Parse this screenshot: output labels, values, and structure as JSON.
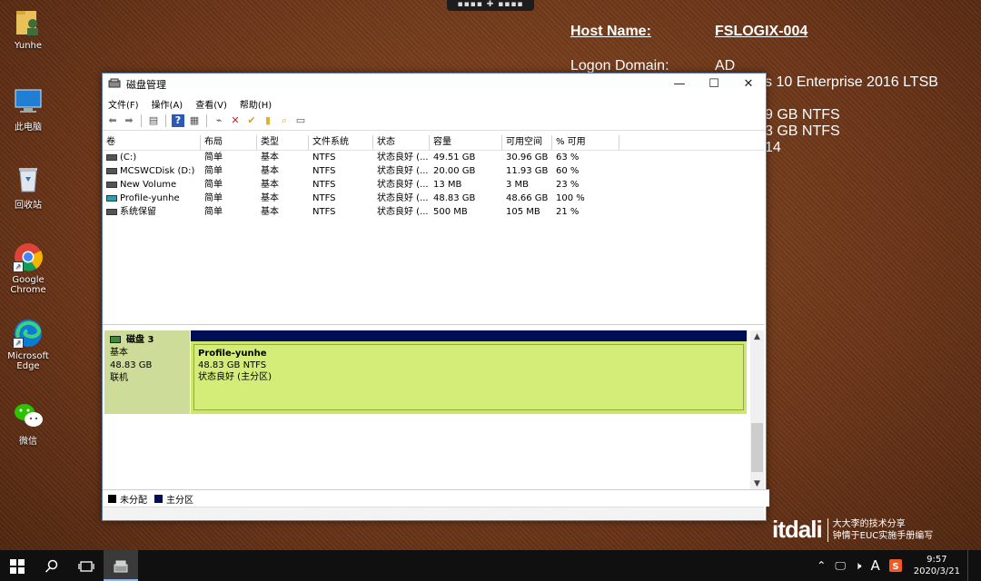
{
  "desktop": {
    "icons": [
      {
        "label": "Yunhe"
      },
      {
        "label": "此电脑"
      },
      {
        "label": "回收站"
      },
      {
        "label": "Google Chrome"
      },
      {
        "label": "Microsoft Edge"
      },
      {
        "label": "微信"
      }
    ]
  },
  "bginfo": {
    "host_label": "Host Name:",
    "host_value": "FSLOGIX-004",
    "domain_label": "Logon Domain:",
    "domain_value": "AD",
    "os_partial": "s 10 Enterprise 2016 LTSB",
    "vol1_partial": "9 GB NTFS",
    "vol2_partial": "3 GB NTFS",
    "line3_partial": "14"
  },
  "window": {
    "title": "磁盘管理",
    "menu": [
      "文件(F)",
      "操作(A)",
      "查看(V)",
      "帮助(H)"
    ],
    "columns": [
      "卷",
      "布局",
      "类型",
      "文件系统",
      "状态",
      "容量",
      "可用空间",
      "% 可用"
    ],
    "volumes": [
      {
        "name": "(C:)",
        "layout": "简单",
        "type": "基本",
        "fs": "NTFS",
        "status": "状态良好 (...",
        "capacity": "49.51 GB",
        "free": "30.96 GB",
        "pct": "63 %"
      },
      {
        "name": "MCSWCDisk (D:)",
        "layout": "简单",
        "type": "基本",
        "fs": "NTFS",
        "status": "状态良好 (...",
        "capacity": "20.00 GB",
        "free": "11.93 GB",
        "pct": "60 %"
      },
      {
        "name": "New Volume",
        "layout": "简单",
        "type": "基本",
        "fs": "NTFS",
        "status": "状态良好 (...",
        "capacity": "13 MB",
        "free": "3 MB",
        "pct": "23 %"
      },
      {
        "name": "Profile-yunhe",
        "layout": "简单",
        "type": "基本",
        "fs": "NTFS",
        "status": "状态良好 (...",
        "capacity": "48.83 GB",
        "free": "48.66 GB",
        "pct": "100 %"
      },
      {
        "name": "系统保留",
        "layout": "简单",
        "type": "基本",
        "fs": "NTFS",
        "status": "状态良好 (...",
        "capacity": "500 MB",
        "free": "105 MB",
        "pct": "21 %"
      }
    ],
    "disk": {
      "title": "磁盘 3",
      "type": "基本",
      "size": "48.83 GB",
      "state": "联机",
      "partition": {
        "name": "Profile-yunhe",
        "detail": "48.83 GB NTFS",
        "status": "状态良好 (主分区)"
      }
    },
    "legend": {
      "unallocated": "未分配",
      "primary": "主分区",
      "unallocated_color": "#000000",
      "primary_color": "#000f55"
    }
  },
  "watermark": {
    "logo": "itdali",
    "line1": "大大李的技术分享",
    "line2": "钟情于EUC实施手册编写"
  },
  "taskbar": {
    "time": "9:57",
    "date": "2020/3/21",
    "ime": "A"
  }
}
